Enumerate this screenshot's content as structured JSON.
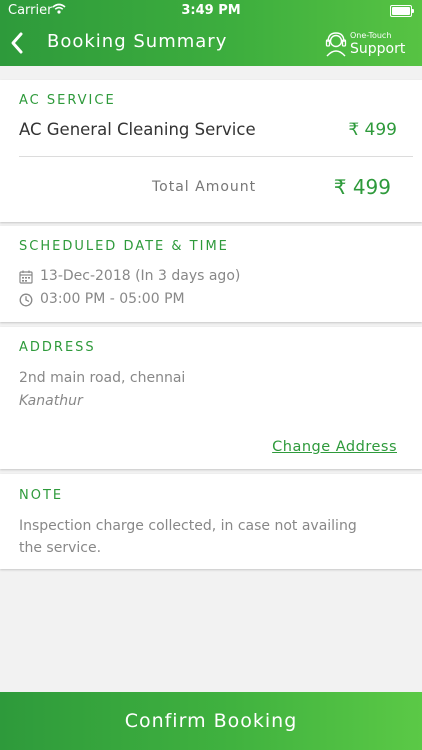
{
  "status_bar": {
    "carrier": "Carrier",
    "time": "3:49 PM"
  },
  "header": {
    "title": "Booking Summary",
    "support_small": "One-Touch",
    "support_big": "Support"
  },
  "service": {
    "label": "AC SERVICE",
    "name": "AC General Cleaning Service",
    "price": "₹ 499",
    "total_label": "Total Amount",
    "total_value": "₹ 499"
  },
  "schedule": {
    "label": "SCHEDULED DATE & TIME",
    "date": "13-Dec-2018 (In 3 days ago)",
    "time": "03:00 PM - 05:00 PM"
  },
  "address": {
    "label": "ADDRESS",
    "line1": "2nd main road, chennai",
    "line2": "Kanathur",
    "change_label": "Change Address"
  },
  "note": {
    "label": "NOTE",
    "line1": "Inspection charge collected, in case not availing",
    "line2": "the service."
  },
  "footer": {
    "confirm_label": "Confirm Booking"
  },
  "colors": {
    "accent": "#2e9a3b",
    "accent_light": "#57c343"
  }
}
